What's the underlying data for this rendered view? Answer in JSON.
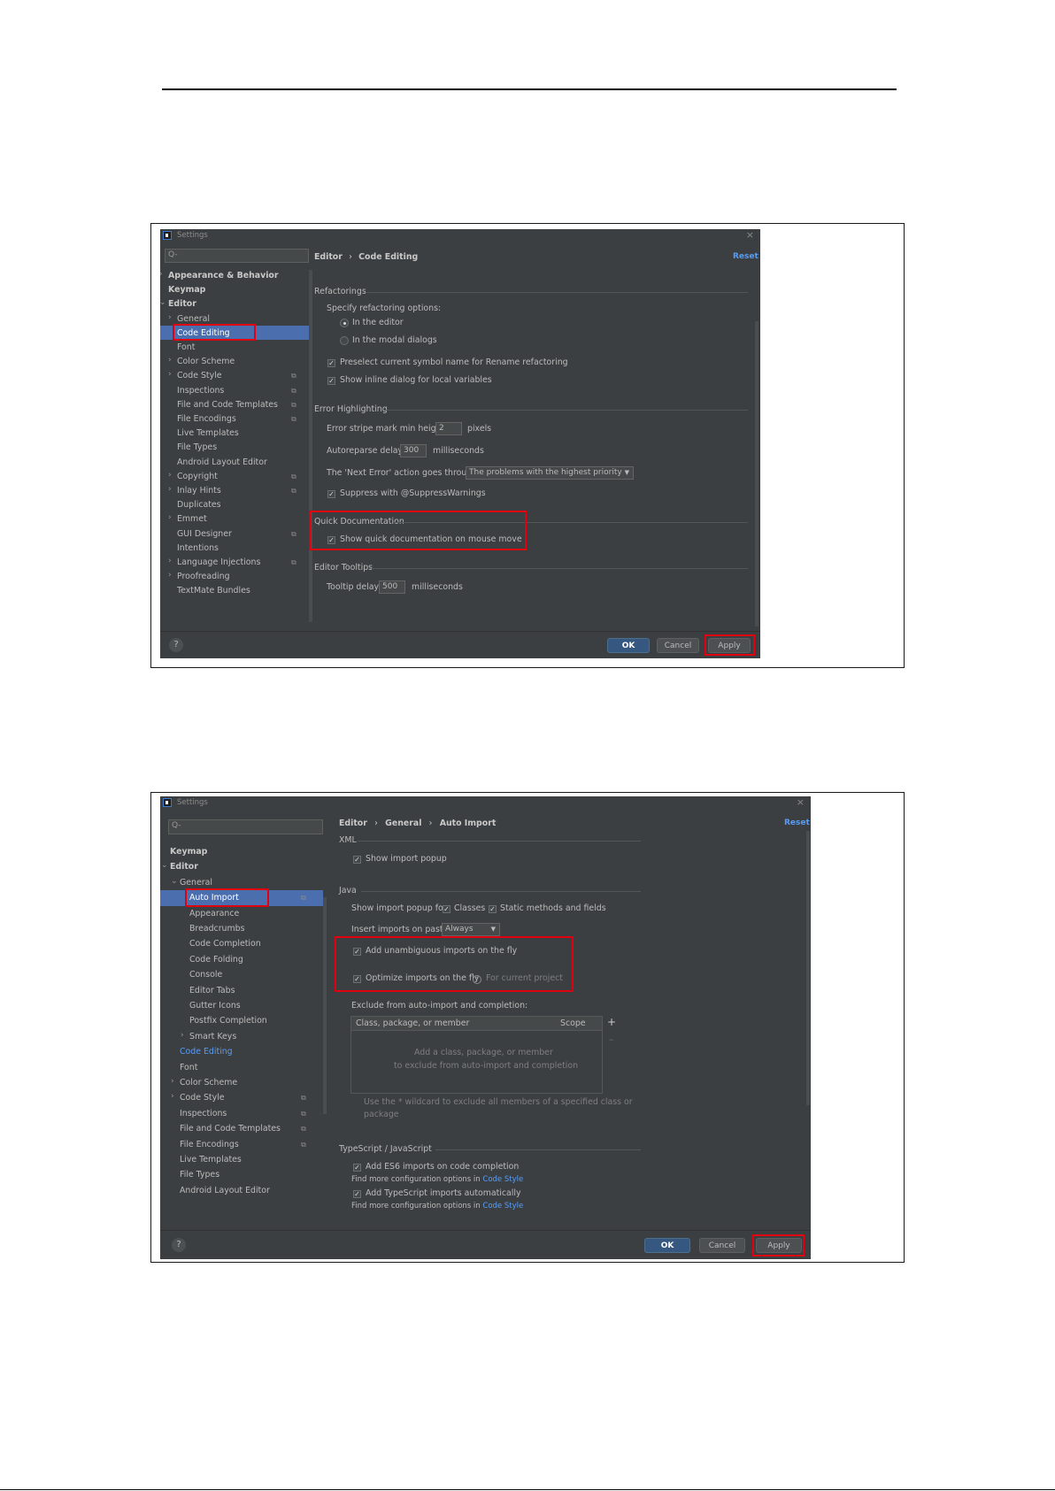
{
  "win1": {
    "title": "Settings",
    "search_placeholder": "Q-",
    "tree": [
      {
        "label": "Appearance & Behavior",
        "bold": true,
        "arrow": "›",
        "indent": 0
      },
      {
        "label": "Keymap",
        "bold": true,
        "indent": 0
      },
      {
        "label": "Editor",
        "bold": true,
        "arrow": "⌄",
        "indent": 0
      },
      {
        "label": "General",
        "arrow": "›",
        "indent": 1
      },
      {
        "label": "Code Editing",
        "selected": true,
        "indent": 1
      },
      {
        "label": "Font",
        "indent": 1
      },
      {
        "label": "Color Scheme",
        "arrow": "›",
        "indent": 1
      },
      {
        "label": "Code Style",
        "arrow": "›",
        "indent": 1,
        "copy": true
      },
      {
        "label": "Inspections",
        "indent": 1,
        "copy": true
      },
      {
        "label": "File and Code Templates",
        "indent": 1,
        "copy": true
      },
      {
        "label": "File Encodings",
        "indent": 1,
        "copy": true
      },
      {
        "label": "Live Templates",
        "indent": 1
      },
      {
        "label": "File Types",
        "indent": 1
      },
      {
        "label": "Android Layout Editor",
        "indent": 1
      },
      {
        "label": "Copyright",
        "arrow": "›",
        "indent": 1,
        "copy": true
      },
      {
        "label": "Inlay Hints",
        "arrow": "›",
        "indent": 1,
        "copy": true
      },
      {
        "label": "Duplicates",
        "indent": 1
      },
      {
        "label": "Emmet",
        "arrow": "›",
        "indent": 1
      },
      {
        "label": "GUI Designer",
        "indent": 1,
        "copy": true
      },
      {
        "label": "Intentions",
        "indent": 1
      },
      {
        "label": "Language Injections",
        "arrow": "›",
        "indent": 1,
        "copy": true
      },
      {
        "label": "Proofreading",
        "arrow": "›",
        "indent": 1
      },
      {
        "label": "TextMate Bundles",
        "indent": 1
      }
    ],
    "breadcrumb": {
      "part1": "Editor",
      "sep": "›",
      "part2": "Code Editing"
    },
    "reset": "Reset",
    "refactorings": {
      "group": "Refactorings",
      "specify": "Specify refactoring options:",
      "radio_editor": "In the editor",
      "radio_modal": "In the modal dialogs",
      "preselect": "Preselect current symbol name for Rename refactoring",
      "inline_dialog": "Show inline dialog for local variables"
    },
    "error_highlighting": {
      "group": "Error Highlighting",
      "stripe_label": "Error stripe mark min height:",
      "stripe_value": "2",
      "stripe_unit": "pixels",
      "autoreparse_label": "Autoreparse delay:",
      "autoreparse_value": "300",
      "autoreparse_unit": "milliseconds",
      "next_error_label": "The 'Next Error' action goes through:",
      "next_error_value": "The problems with the highest priority",
      "suppress": "Suppress with @SuppressWarnings"
    },
    "quick_doc": {
      "group": "Quick Documentation",
      "show": "Show quick documentation on mouse move"
    },
    "tooltips": {
      "group": "Editor Tooltips",
      "delay_label": "Tooltip delay:",
      "delay_value": "500",
      "delay_unit": "milliseconds"
    },
    "buttons": {
      "help": "?",
      "ok": "OK",
      "cancel": "Cancel",
      "apply": "Apply"
    }
  },
  "win2": {
    "title": "Settings",
    "search_placeholder": "Q-",
    "tree": [
      {
        "label": "Keymap",
        "bold": true,
        "indent": 0
      },
      {
        "label": "Editor",
        "bold": true,
        "arrow": "⌄",
        "indent": 0
      },
      {
        "label": "General",
        "arrow": "⌄",
        "indent": 1
      },
      {
        "label": "Auto Import",
        "selected": true,
        "indent": 2,
        "copy": true
      },
      {
        "label": "Appearance",
        "indent": 2
      },
      {
        "label": "Breadcrumbs",
        "indent": 2
      },
      {
        "label": "Code Completion",
        "indent": 2
      },
      {
        "label": "Code Folding",
        "indent": 2
      },
      {
        "label": "Console",
        "indent": 2
      },
      {
        "label": "Editor Tabs",
        "indent": 2
      },
      {
        "label": "Gutter Icons",
        "indent": 2
      },
      {
        "label": "Postfix Completion",
        "indent": 2
      },
      {
        "label": "Smart Keys",
        "arrow": "›",
        "indent": 2
      },
      {
        "label": "Code Editing",
        "link": true,
        "indent": 1
      },
      {
        "label": "Font",
        "indent": 1
      },
      {
        "label": "Color Scheme",
        "arrow": "›",
        "indent": 1
      },
      {
        "label": "Code Style",
        "arrow": "›",
        "indent": 1,
        "copy": true
      },
      {
        "label": "Inspections",
        "indent": 1,
        "copy": true
      },
      {
        "label": "File and Code Templates",
        "indent": 1,
        "copy": true
      },
      {
        "label": "File Encodings",
        "indent": 1,
        "copy": true
      },
      {
        "label": "Live Templates",
        "indent": 1
      },
      {
        "label": "File Types",
        "indent": 1
      },
      {
        "label": "Android Layout Editor",
        "indent": 1
      }
    ],
    "breadcrumb": {
      "part1": "Editor",
      "sep1": "›",
      "part2": "General",
      "sep2": "›",
      "part3": "Auto Import"
    },
    "reset": "Reset",
    "xml": {
      "group": "XML",
      "show_popup": "Show import popup"
    },
    "java": {
      "group": "Java",
      "popup_for": "Show import popup for:",
      "classes": "Classes",
      "static": "Static methods and fields",
      "insert_label": "Insert imports on paste:",
      "insert_value": "Always",
      "add_unambiguous": "Add unambiguous imports on the fly",
      "optimize": "Optimize imports on the fly",
      "for_project": "For current project",
      "exclude_label": "Exclude from auto-import and completion:",
      "col_member": "Class, package, or member",
      "col_scope": "Scope",
      "empty1": "Add a class, package, or member",
      "empty2": "to exclude from auto-import and completion",
      "wildcard1": "Use the * wildcard to exclude all members of a specified class or",
      "wildcard2": "package"
    },
    "ts": {
      "group": "TypeScript / JavaScript",
      "es6": "Add ES6 imports on code completion",
      "find_more1": "Find more configuration options in",
      "code_style1": "Code Style",
      "ts_auto": "Add TypeScript imports automatically",
      "find_more2": "Find more configuration options in",
      "code_style2": "Code Style"
    },
    "buttons": {
      "help": "?",
      "ok": "OK",
      "cancel": "Cancel",
      "apply": "Apply"
    }
  }
}
